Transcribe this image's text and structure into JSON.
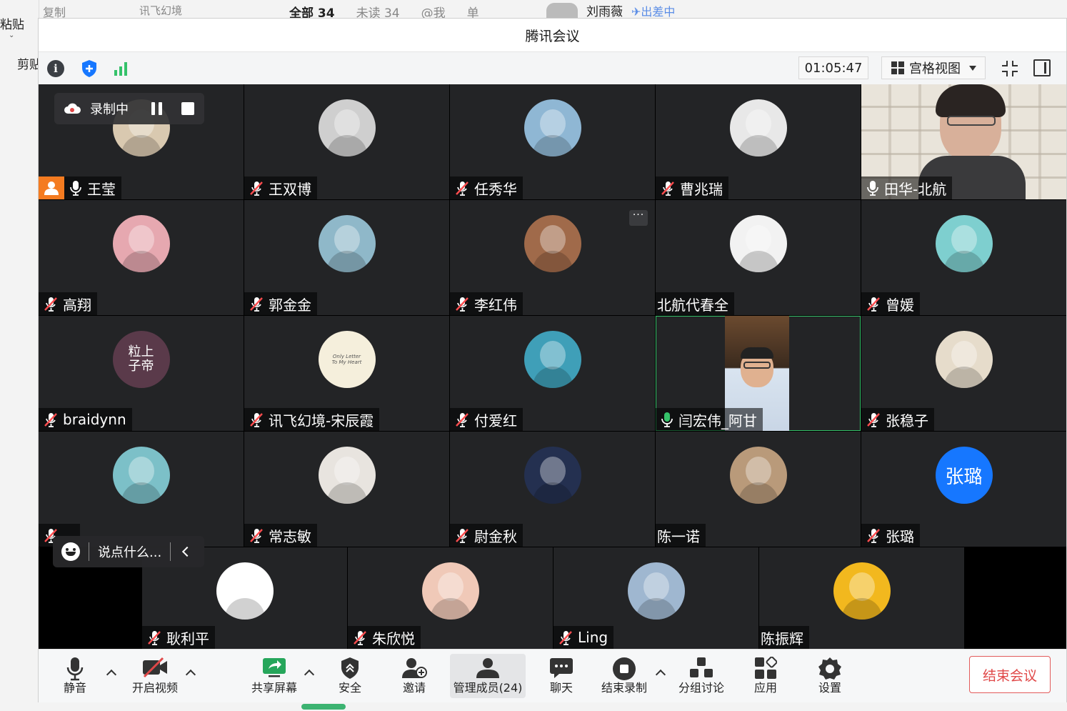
{
  "background": {
    "paste_label": "粘贴",
    "cut_label": "剪贴",
    "copy_label": "复制",
    "app_tab_label": "讯飞幻境",
    "mail_tabs": [
      "全部 34",
      "未读 34",
      "@我",
      "单"
    ],
    "user_name": "刘雨薇",
    "user_status": "出差中"
  },
  "window": {
    "title": "腾讯会议",
    "timer": "01:05:47",
    "view_label": "宫格视图"
  },
  "recording": {
    "label": "录制中"
  },
  "chat": {
    "placeholder": "说点什么..."
  },
  "participants": [
    {
      "name": "王莹",
      "mic": "on",
      "host": true,
      "avatar_color": "#d9c9b0"
    },
    {
      "name": "王双博",
      "mic": "muted",
      "avatar_color": "#cfcfcf"
    },
    {
      "name": "任秀华",
      "mic": "muted",
      "avatar_color": "#8fb7d4"
    },
    {
      "name": "曹兆瑞",
      "mic": "muted",
      "avatar_color": "#e8e8e8"
    },
    {
      "name": "田华-北航",
      "mic": "on",
      "video": true
    },
    {
      "name": "高翔",
      "mic": "muted",
      "avatar_color": "#e6a8b0"
    },
    {
      "name": "郭金金",
      "mic": "muted",
      "avatar_color": "#8fb8c9"
    },
    {
      "name": "李红伟",
      "mic": "muted",
      "avatar_color": "#a06a4a",
      "more": "···"
    },
    {
      "name": "北航代春全",
      "mic": "none",
      "avatar_color": "#f2f2f2"
    },
    {
      "name": "曾媛",
      "mic": "muted",
      "avatar_color": "#7ecfcf"
    },
    {
      "name": "braidynn",
      "mic": "muted",
      "avatar_color": "#5a3a4a",
      "avatar_text": "粒上 子帝"
    },
    {
      "name": "讯飞幻境-宋辰霞",
      "mic": "muted",
      "avatar_color": "#f5efdc",
      "avatar_text": "Only Letter To My Heart"
    },
    {
      "name": "付爱红",
      "mic": "muted",
      "avatar_color": "#3f9fb8"
    },
    {
      "name": "闫宏伟_阿甘",
      "mic": "speaking",
      "video": true
    },
    {
      "name": "张稳子",
      "mic": "muted",
      "avatar_color": "#e6dccb"
    },
    {
      "name": "",
      "mic": "muted",
      "avatar_color": "#7cc0c8"
    },
    {
      "name": "常志敏",
      "mic": "muted",
      "avatar_color": "#e8e4df"
    },
    {
      "name": "尉金秋",
      "mic": "muted",
      "avatar_color": "#243050"
    },
    {
      "name": "陈一诺",
      "mic": "none",
      "avatar_color": "#b99a7a"
    },
    {
      "name": "张璐",
      "mic": "muted",
      "avatar_color": "#1677ff",
      "avatar_text": "张璐"
    },
    {
      "name": "耿利平",
      "mic": "muted",
      "avatar_color": "#ffffff"
    },
    {
      "name": "朱欣悦",
      "mic": "muted",
      "avatar_color": "#f0c9b8"
    },
    {
      "name": "Ling",
      "mic": "muted",
      "avatar_color": "#9fb7d0"
    },
    {
      "name": "陈振辉",
      "mic": "none",
      "avatar_color": "#f2b81e"
    }
  ],
  "toolbar": {
    "mute": "静音",
    "video": "开启视频",
    "share": "共享屏幕",
    "security": "安全",
    "invite": "邀请",
    "members": "管理成员(24)",
    "chat": "聊天",
    "stop_record": "结束录制",
    "breakout": "分组讨论",
    "apps": "应用",
    "settings": "设置",
    "end_meeting": "结束会议"
  },
  "colors": {
    "accent": "#1677ff",
    "end_red": "#e04848",
    "speaking_green": "#35c26a",
    "host_orange": "#f47b20",
    "tile_bg": "#232426"
  }
}
